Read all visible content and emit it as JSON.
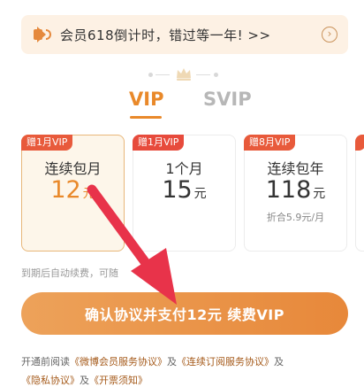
{
  "banner": {
    "text": "会员618倒计时，错过等一年! >>",
    "chevron": "›",
    "icon": "speaker-icon"
  },
  "tabs": [
    {
      "label": "VIP",
      "active": true
    },
    {
      "label": "SVIP",
      "active": false
    }
  ],
  "plans": [
    {
      "badge": "赠1月VIP",
      "name": "连续包月",
      "price": "12",
      "unit": "元",
      "note": "",
      "selected": true
    },
    {
      "badge": "赠1月VIP",
      "name": "1个月",
      "price": "15",
      "unit": "元",
      "note": "",
      "selected": false
    },
    {
      "badge": "赠8月VIP",
      "name": "连续包年",
      "price": "118",
      "unit": "元",
      "note": "折合5.9元/月",
      "selected": false
    }
  ],
  "auto_renew_text": "到期后自动续费，可随",
  "pay_button": "确认协议并支付12元 续费VIP",
  "agreement": {
    "prefix": "开通前阅读",
    "link1": "《微博会员服务协议》",
    "and1": "及",
    "link2": "《连续订阅服务协议》",
    "and2": "及",
    "link3": "《隐私协议》",
    "and3": "及",
    "link4": "《开票须知》"
  },
  "colors": {
    "accent": "#e9892a",
    "badge": "#e85a3b",
    "banner_bg": "#fdf1e4",
    "arrow": "#e8334a"
  }
}
